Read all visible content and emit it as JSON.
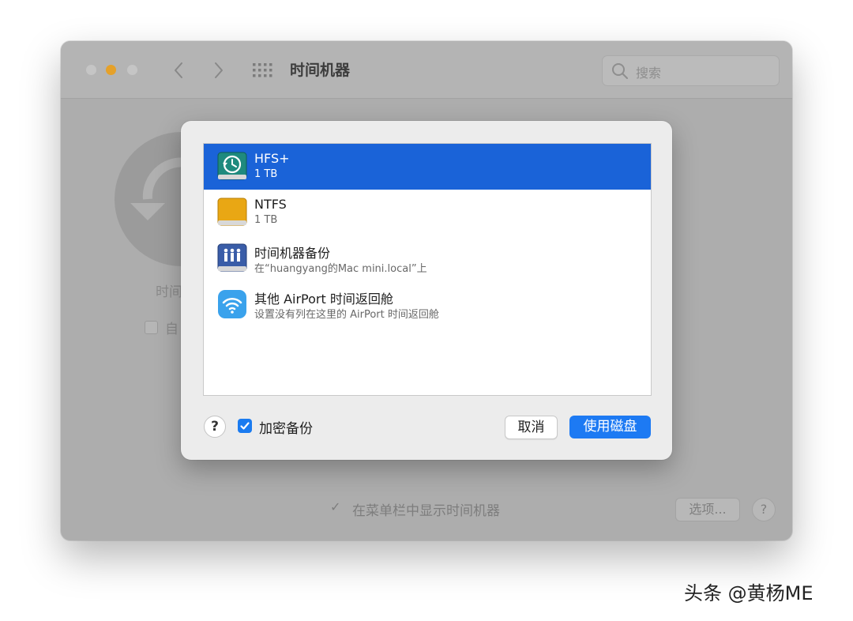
{
  "window": {
    "title": "时间机器",
    "search_placeholder": "搜索",
    "background_label": "时间",
    "background_checkbox_label": "自",
    "show_in_menu_bar_label": "在菜单栏中显示时间机器",
    "options_button": "选项...",
    "help_button": "?"
  },
  "sheet": {
    "disks": [
      {
        "title": "HFS+",
        "subtitle": "1 TB",
        "icon": "time-machine-disk-icon",
        "selected": true
      },
      {
        "title": "NTFS",
        "subtitle": "1 TB",
        "icon": "external-drive-icon",
        "selected": false
      },
      {
        "title": "时间机器备份",
        "subtitle": "在“huangyang的Mac mini.local”上",
        "icon": "network-share-icon",
        "selected": false
      },
      {
        "title": "其他 AirPort 时间返回舱",
        "subtitle": "设置没有列在这里的 AirPort 时间返回舱",
        "icon": "airport-wifi-icon",
        "selected": false
      }
    ],
    "help_button": "?",
    "encrypt_label": "加密备份",
    "encrypt_checked": true,
    "cancel_button": "取消",
    "use_disk_button": "使用磁盘"
  },
  "watermark": "头条 @黄杨ME",
  "colors": {
    "selection": "#1a63d8",
    "accent": "#1d7af3",
    "minimize": "#e5a12a"
  }
}
